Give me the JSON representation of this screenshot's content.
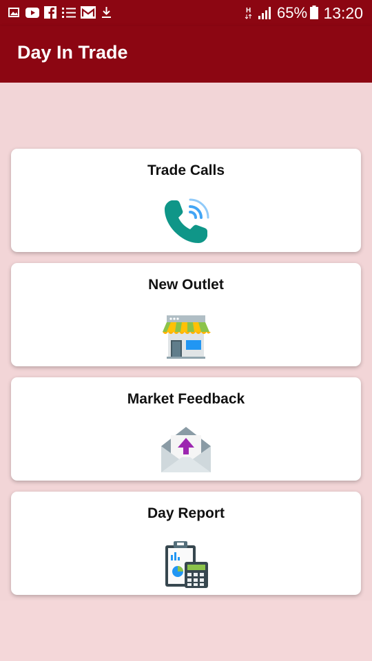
{
  "status_bar": {
    "battery_percent": "65%",
    "time": "13:20",
    "icons": [
      "image-icon",
      "youtube-icon",
      "facebook-icon",
      "list-icon",
      "gmail-icon",
      "download-icon",
      "hplus-icon",
      "signal-icon",
      "battery-icon"
    ]
  },
  "app_bar": {
    "title": "Day In Trade"
  },
  "cards": [
    {
      "label": "Trade Calls",
      "icon": "phone-call-icon"
    },
    {
      "label": "New Outlet",
      "icon": "shop-icon"
    },
    {
      "label": "Market Feedback",
      "icon": "envelope-upload-icon"
    },
    {
      "label": "Day Report",
      "icon": "report-calculator-icon"
    }
  ],
  "colors": {
    "primary": "#8c0612",
    "background": "#f4d7d9",
    "card": "#ffffff"
  }
}
